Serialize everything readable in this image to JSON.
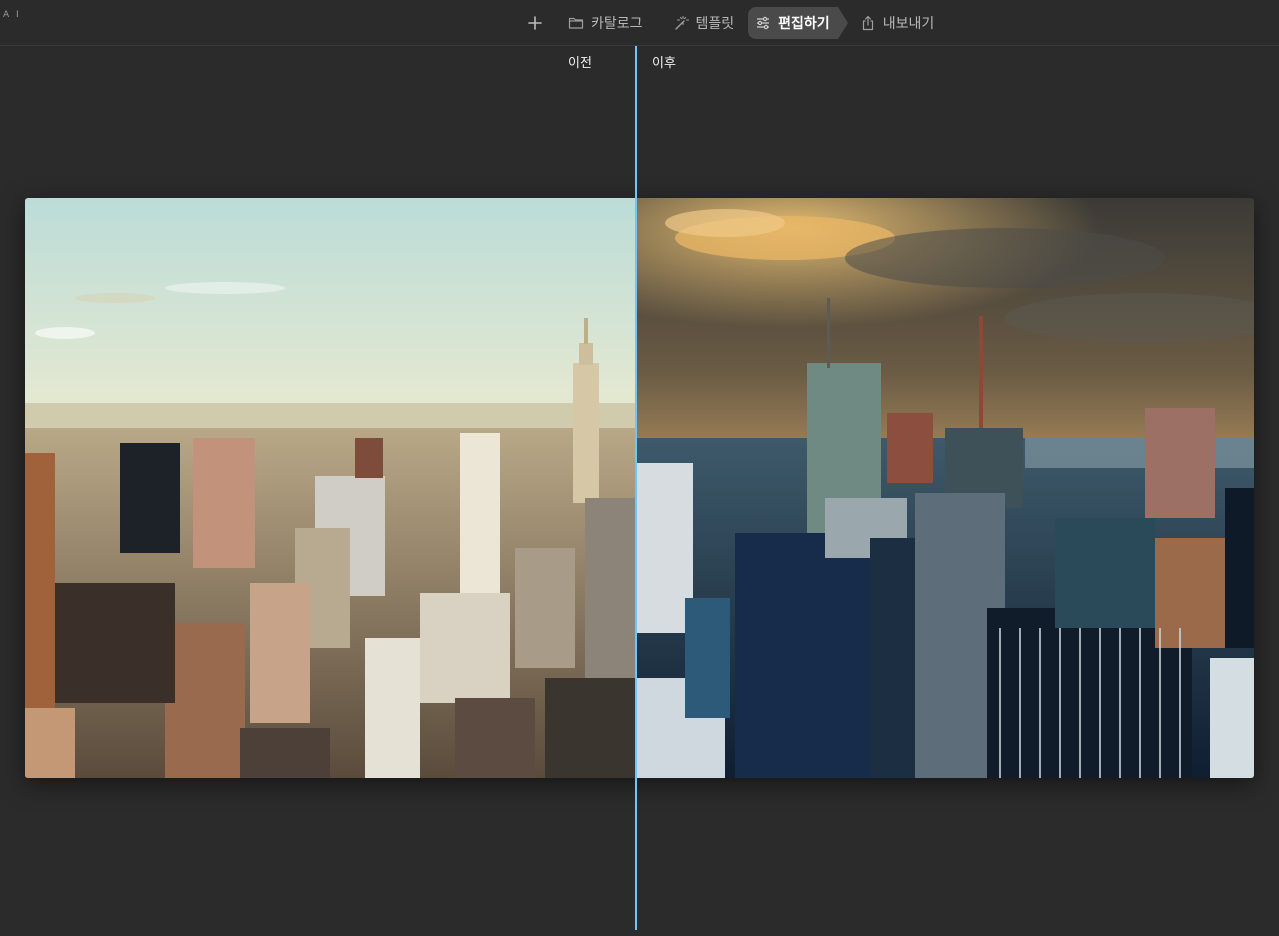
{
  "app": {
    "mark": "A I"
  },
  "toolbar": {
    "add_label": "+",
    "items": [
      {
        "label": "카탈로그",
        "icon": "folder-icon",
        "active": false
      },
      {
        "label": "템플릿",
        "icon": "magic-wand-icon",
        "active": false
      },
      {
        "label": "편집하기",
        "icon": "sliders-icon",
        "active": true
      },
      {
        "label": "내보내기",
        "icon": "share-icon",
        "active": false
      }
    ]
  },
  "compare": {
    "before_label": "이전",
    "after_label": "이후"
  },
  "colors": {
    "background": "#2b2b2b",
    "active_tab": "#4a4a4a",
    "divider": "#6ec6ff"
  }
}
